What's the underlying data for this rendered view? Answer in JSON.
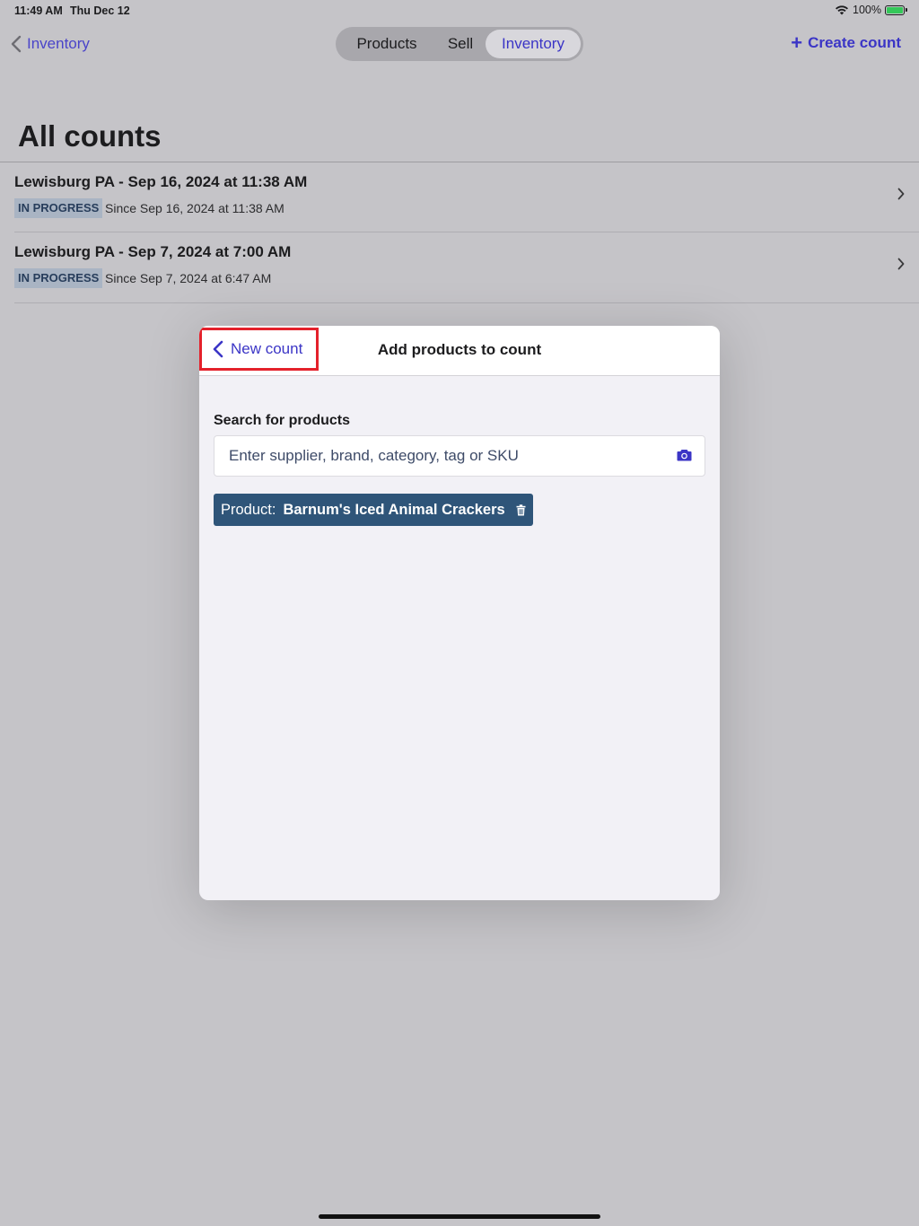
{
  "status_bar": {
    "time": "11:49 AM",
    "date": "Thu Dec 12",
    "battery": "100%",
    "icons": [
      "wifi-icon",
      "battery-charging-icon"
    ]
  },
  "nav": {
    "back_label": "Inventory",
    "segments": [
      {
        "label": "Products",
        "active": false
      },
      {
        "label": "Sell",
        "active": false
      },
      {
        "label": "Inventory",
        "active": true
      }
    ],
    "create_label": "Create count"
  },
  "page": {
    "title": "All counts"
  },
  "counts": [
    {
      "title": "Lewisburg PA - Sep 16, 2024 at 11:38 AM",
      "status": "IN PROGRESS",
      "since": "Since Sep 16, 2024 at 11:38 AM"
    },
    {
      "title": "Lewisburg PA - Sep 7, 2024 at 7:00 AM",
      "status": "IN PROGRESS",
      "since": "Since Sep 7, 2024 at 6:47 AM"
    }
  ],
  "modal": {
    "back_label": "New count",
    "title": "Add products to count",
    "search_label": "Search for products",
    "search_placeholder": "Enter supplier, brand, category, tag or SKU",
    "search_value": "",
    "filter_chip": {
      "key": "Product:",
      "value": "Barnum's Iced Animal Crackers"
    }
  },
  "colors": {
    "accent": "#3b35c6",
    "chip_bg": "#2f5579",
    "badge_bg": "#a9b4c3",
    "highlight_border": "#e4212b",
    "battery_green": "#34c759"
  }
}
